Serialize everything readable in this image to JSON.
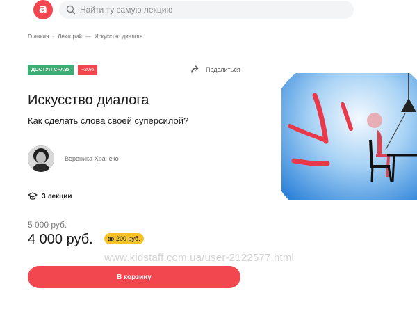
{
  "header": {
    "logo_letter": "a",
    "search_placeholder": "Найти ту самую лекцию"
  },
  "breadcrumbs": {
    "items": [
      "Главная",
      "Лекторий",
      "Искусство диалога"
    ],
    "separators": [
      "·",
      "—"
    ]
  },
  "badges": {
    "access": "ДОСТУП СРАЗУ",
    "discount": "−20%"
  },
  "share_label": "Поделиться",
  "lecture": {
    "title": "Искусство диалога",
    "subtitle": "Как сделать слова своей суперсилой?",
    "author": "Вероника Хранеко",
    "lectures_count": "3 лекции"
  },
  "pricing": {
    "old_price": "5 000 руб.",
    "price": "4 000 руб.",
    "bonus": "200 руб."
  },
  "cart_button": "В корзину",
  "watermark": "www.kidstaff.com.ua/user-2122577.html",
  "colors": {
    "brand_red": "#f2474f",
    "access_green": "#3fae74",
    "bonus_yellow": "#f6c226",
    "illustration_blue": "#3c8fe0"
  },
  "icons": [
    "search-icon",
    "share-icon",
    "graduation-cap-icon",
    "coin-icon"
  ]
}
